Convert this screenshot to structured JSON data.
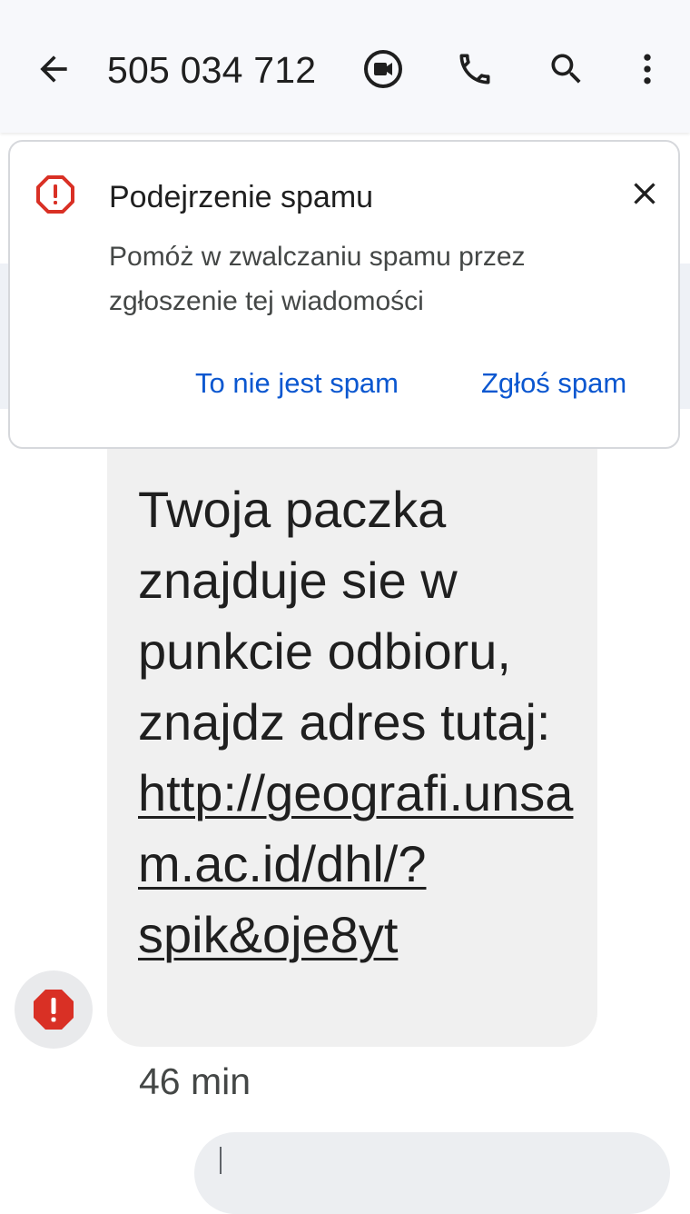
{
  "appbar": {
    "title": "505 034 712",
    "icons": [
      "arrow-back-icon",
      "video-call-icon",
      "phone-icon",
      "search-icon",
      "more-vert-icon"
    ]
  },
  "spam_banner": {
    "heading": "Podejrzenie spamu",
    "body": "Pomóż w zwalczaniu spamu przez zgłoszenie tej wiadomości",
    "not_spam_label": "To nie jest spam",
    "report_label": "Zgłoś spam",
    "accent_color": "#0b57d0",
    "warning_color": "#d93025"
  },
  "message": {
    "text_before_link": "Twoja paczka znajduje sie w punkcie odbioru, znajdz adres tutaj: ",
    "link": "http://geografi.unsam.ac.id/dhl/?spik&oje8yt",
    "timestamp": "46 min"
  }
}
